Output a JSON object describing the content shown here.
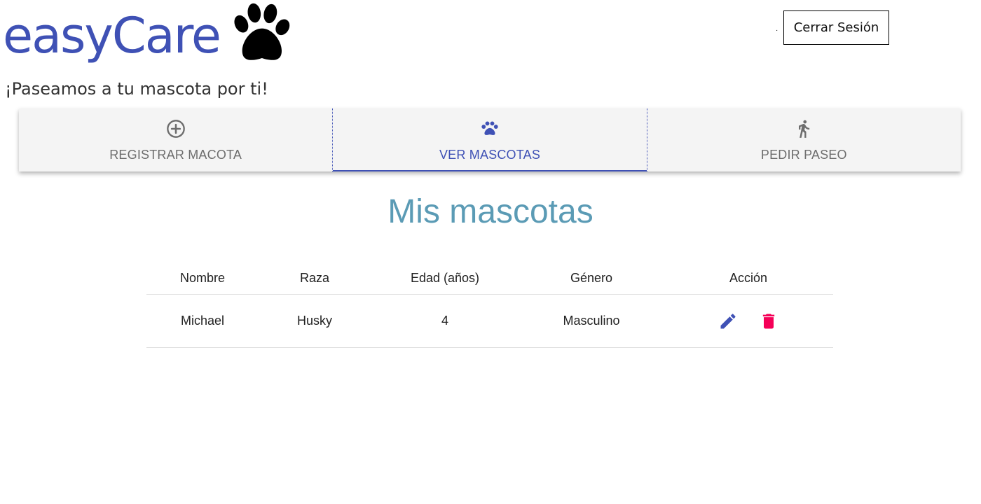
{
  "header": {
    "logo_text": "easyCare",
    "logo_icon": "paw-icon",
    "tagline": "¡Paseamos a tu mascota por ti!",
    "dot": "·",
    "logout_label": "Cerrar Sesión"
  },
  "tabs": [
    {
      "label": "Registrar Macota",
      "icon": "add-circle-icon",
      "active": false
    },
    {
      "label": "Ver Mascotas",
      "icon": "paw-icon",
      "active": true
    },
    {
      "label": "Pedir Paseo",
      "icon": "walk-icon",
      "active": false
    }
  ],
  "main": {
    "title": "Mis mascotas",
    "table": {
      "headers": [
        "Nombre",
        "Raza",
        "Edad (años)",
        "Género",
        "Acción"
      ],
      "rows": [
        {
          "name": "Michael",
          "breed": "Husky",
          "age": "4",
          "gender": "Masculino",
          "actions": [
            "edit-icon",
            "delete-icon"
          ]
        }
      ]
    }
  },
  "colors": {
    "brand": "#3f51b5",
    "title": "#5b9bb5",
    "delete": "#f50057",
    "tab_bg": "#f4f4f4"
  }
}
